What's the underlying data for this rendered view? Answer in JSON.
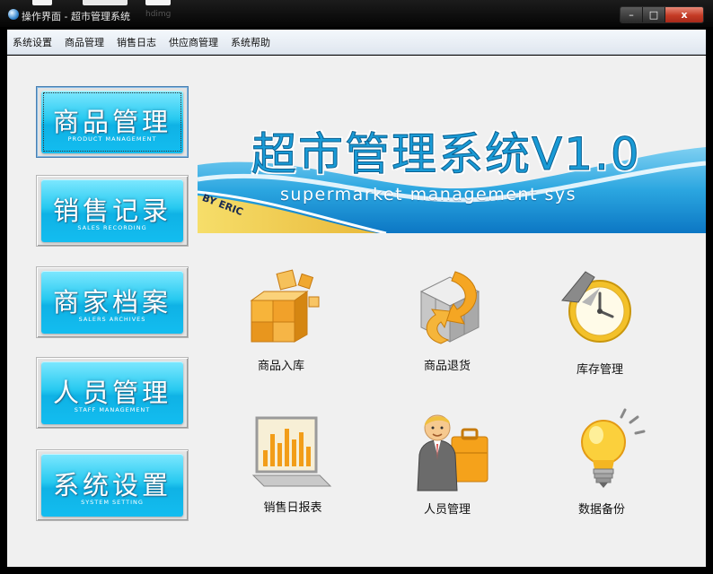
{
  "window": {
    "title": "操作界面 - 超市管理系统",
    "ghost_tab": "hdimg",
    "minimize": "–",
    "maximize": "□",
    "close": "x"
  },
  "menu": [
    "系统设置",
    "商品管理",
    "销售日志",
    "供应商管理",
    "系统帮助"
  ],
  "nav_buttons": [
    {
      "cn": "商品管理",
      "en": "PRODUCT MANAGEMENT"
    },
    {
      "cn": "销售记录",
      "en": "SALES RECORDING"
    },
    {
      "cn": "商家档案",
      "en": "SALERS ARCHIVES"
    },
    {
      "cn": "人员管理",
      "en": "STAFF MANAGEMENT"
    },
    {
      "cn": "系统设置",
      "en": "SYSTEM SETTING"
    }
  ],
  "banner": {
    "title": "超市管理系统V1.0",
    "subtitle": "supermarket management sys",
    "by": "BY ERIC"
  },
  "functions": [
    {
      "label": "商品入库",
      "icon": "cube-blocks-icon"
    },
    {
      "label": "商品退货",
      "icon": "return-arrow-cube-icon"
    },
    {
      "label": "库存管理",
      "icon": "clock-icon"
    },
    {
      "label": "销售日报表",
      "icon": "bar-chart-monitor-icon"
    },
    {
      "label": "人员管理",
      "icon": "businessman-icon"
    },
    {
      "label": "数据备份",
      "icon": "lightbulb-icon"
    }
  ],
  "colors": {
    "nav_button": "#19bff0",
    "banner_blue": "#1a9bd6",
    "banner_sand": "#f2d25a",
    "client_bg": "#f0f0f0"
  }
}
